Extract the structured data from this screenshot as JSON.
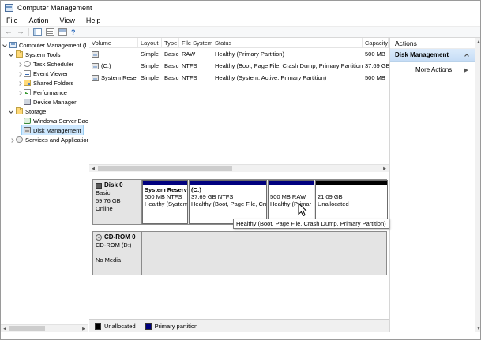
{
  "window": {
    "title": "Computer Management"
  },
  "menu": {
    "items": [
      "File",
      "Action",
      "View",
      "Help"
    ]
  },
  "toolbar": {
    "icons": [
      "back-arrow",
      "forward-arrow",
      "show-console-tree-icon",
      "export-list-icon",
      "properties-icon",
      "help-icon"
    ]
  },
  "tree": {
    "items": [
      {
        "label": "Computer Management (Local",
        "indent": 0,
        "icon": "computer",
        "expanded": true,
        "selected": false
      },
      {
        "label": "System Tools",
        "indent": 1,
        "icon": "folder",
        "expanded": true,
        "selected": false
      },
      {
        "label": "Task Scheduler",
        "indent": 2,
        "icon": "task",
        "expanded": false,
        "selected": false
      },
      {
        "label": "Event Viewer",
        "indent": 2,
        "icon": "event",
        "expanded": false,
        "selected": false
      },
      {
        "label": "Shared Folders",
        "indent": 2,
        "icon": "shared",
        "expanded": false,
        "selected": false
      },
      {
        "label": "Performance",
        "indent": 2,
        "icon": "performance",
        "expanded": false,
        "selected": false
      },
      {
        "label": "Device Manager",
        "indent": 2,
        "icon": "device",
        "expanded": false,
        "selected": false
      },
      {
        "label": "Storage",
        "indent": 1,
        "icon": "folder",
        "expanded": true,
        "selected": false
      },
      {
        "label": "Windows Server Backup",
        "indent": 2,
        "icon": "backup",
        "expanded": false,
        "selected": false
      },
      {
        "label": "Disk Management",
        "indent": 2,
        "icon": "disk",
        "expanded": false,
        "selected": true
      },
      {
        "label": "Services and Applications",
        "indent": 1,
        "icon": "services",
        "expanded": false,
        "selected": false
      }
    ]
  },
  "volume_list": {
    "columns": [
      "Volume",
      "Layout",
      "Type",
      "File System",
      "Status",
      "Capacity"
    ],
    "rows": [
      {
        "volume": "",
        "layout": "Simple",
        "type": "Basic",
        "file_system": "RAW",
        "status": "Healthy (Primary Partition)",
        "capacity": "500 MB"
      },
      {
        "volume": "(C:)",
        "layout": "Simple",
        "type": "Basic",
        "file_system": "NTFS",
        "status": "Healthy (Boot, Page File, Crash Dump, Primary Partition)",
        "capacity": "37.69 GB"
      },
      {
        "volume": "System Reserved",
        "layout": "Simple",
        "type": "Basic",
        "file_system": "NTFS",
        "status": "Healthy (System, Active, Primary Partition)",
        "capacity": "500 MB"
      }
    ]
  },
  "disk_view": {
    "disk0": {
      "name": "Disk 0",
      "type": "Basic",
      "size": "59.76 GB",
      "status": "Online",
      "partitions": [
        {
          "title": "System Reserv",
          "line1": "500 MB NTFS",
          "line2": "Healthy (System",
          "kind": "primary"
        },
        {
          "title": "(C:)",
          "line1": "37.69 GB NTFS",
          "line2": "Healthy (Boot, Page File, Cras",
          "kind": "primary"
        },
        {
          "title": "",
          "line1": "500 MB RAW",
          "line2": "Healthy (Primar",
          "kind": "primary"
        },
        {
          "title": "",
          "line1": "21.09 GB",
          "line2": "Unallocated",
          "kind": "unallocated"
        }
      ]
    },
    "cdrom": {
      "name": "CD-ROM 0",
      "type": "CD-ROM (D:)",
      "media": "No Media"
    }
  },
  "tooltip": {
    "text": "Healthy (Boot, Page File, Crash Dump, Primary Partition)"
  },
  "legend": {
    "items": [
      {
        "label": "Unallocated",
        "color": "#000000"
      },
      {
        "label": "Primary partition",
        "color": "#00007e"
      }
    ]
  },
  "actions": {
    "title": "Actions",
    "section": "Disk Management",
    "more_actions": "More Actions"
  },
  "colors": {
    "primary_partition": "#00007e",
    "unallocated": "#000000",
    "tree_selection": "#cde8ff",
    "actions_header": "#cfe3f9"
  }
}
